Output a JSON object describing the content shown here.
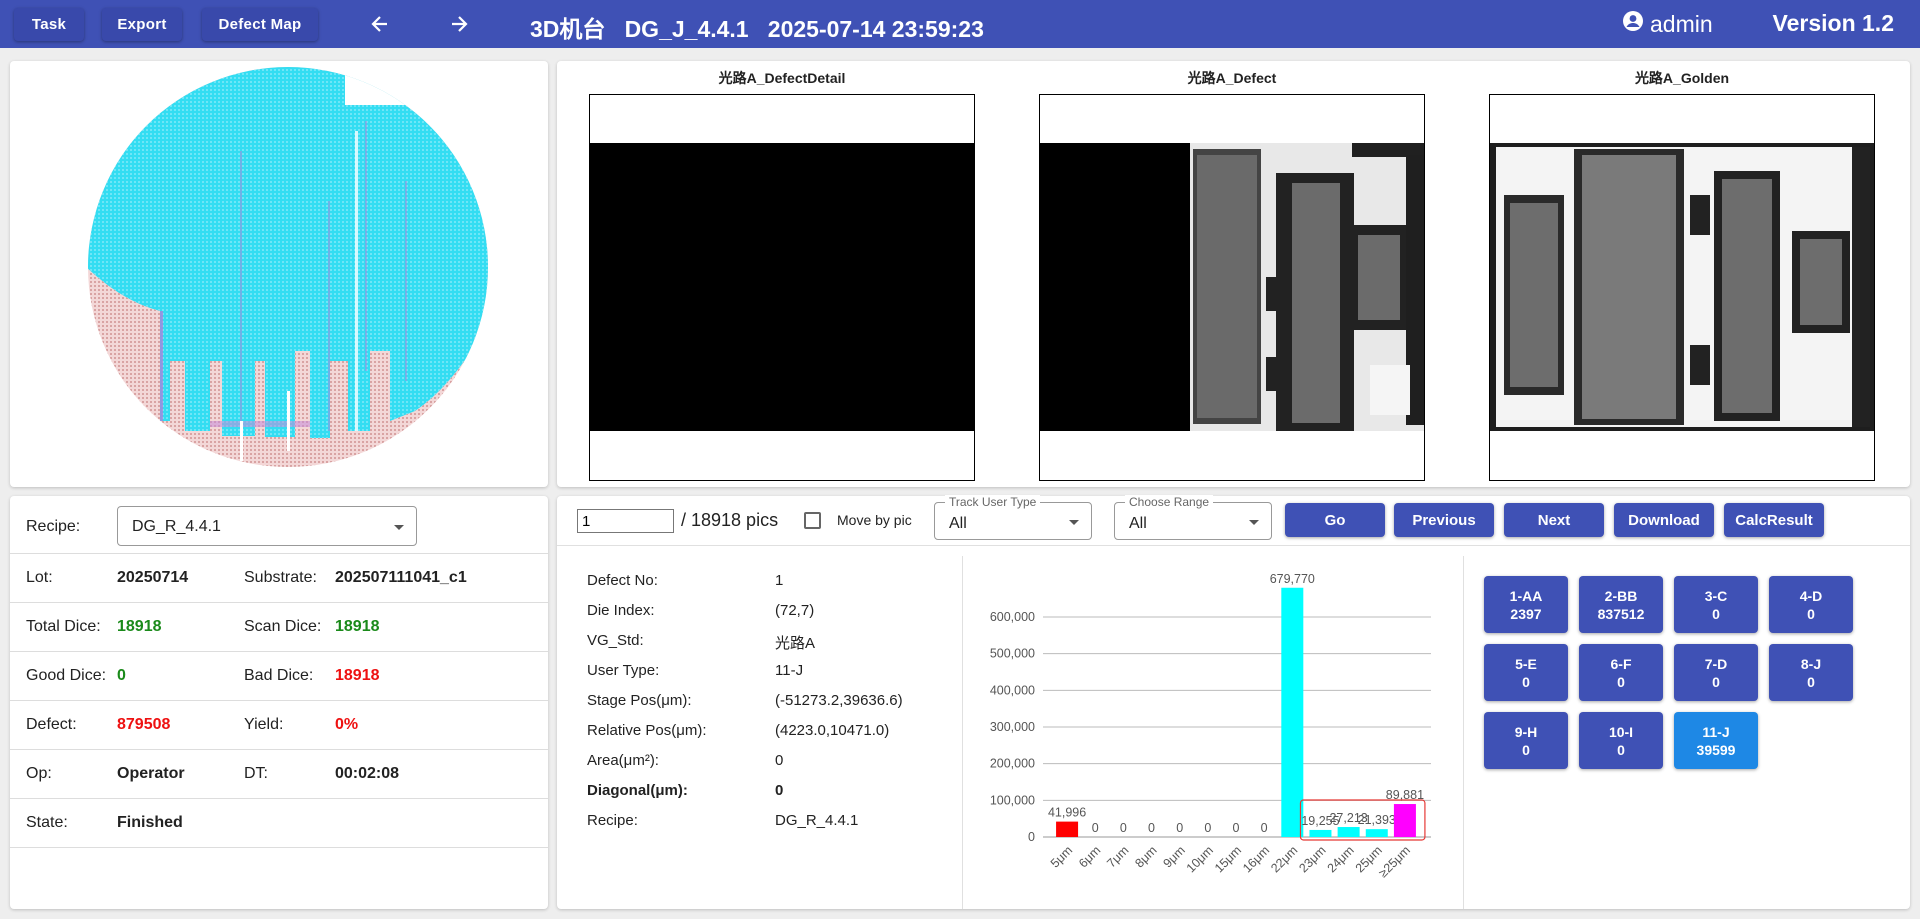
{
  "toolbar": {
    "task_label": "Task",
    "export_label": "Export",
    "defect_map_label": "Defect Map",
    "title": "3D机台   DG_J_4.4.1   2025-07-14 23:59:23",
    "user": "admin",
    "version": "Version 1.2"
  },
  "images": [
    {
      "title": "光路A_DefectDetail"
    },
    {
      "title": "光路A_Defect"
    },
    {
      "title": "光路A_Golden"
    }
  ],
  "info": {
    "recipe_label": "Recipe:",
    "recipe_value": "DG_R_4.4.1",
    "lot_label": "Lot:",
    "lot_value": "20250714",
    "substrate_label": "Substrate:",
    "substrate_value": "202507111041_c1",
    "total_dice_label": "Total Dice:",
    "total_dice_value": "18918",
    "scan_dice_label": "Scan Dice:",
    "scan_dice_value": "18918",
    "good_dice_label": "Good Dice:",
    "good_dice_value": "0",
    "bad_dice_label": "Bad Dice:",
    "bad_dice_value": "18918",
    "defect_label": "Defect:",
    "defect_value": "879508",
    "yield_label": "Yield:",
    "yield_value": "0%",
    "op_label": "Op:",
    "op_value": "Operator",
    "dt_label": "DT:",
    "dt_value": "00:02:08",
    "state_label": "State:",
    "state_value": "Finished"
  },
  "controls": {
    "page_value": "1",
    "page_total": "/ 18918 pics",
    "move_by_pic_label": "Move by pic",
    "track_user_type_label": "Track User Type",
    "track_user_type_value": "All",
    "choose_range_label": "Choose Range",
    "choose_range_value": "All",
    "go_label": "Go",
    "previous_label": "Previous",
    "next_label": "Next",
    "download_label": "Download",
    "calc_result_label": "CalcResult"
  },
  "defect": {
    "rows": [
      {
        "label": "Defect No:",
        "value": "1",
        "bold": false
      },
      {
        "label": "Die Index:",
        "value": "(72,7)",
        "bold": false
      },
      {
        "label": "VG_Std:",
        "value": "光路A",
        "bold": false
      },
      {
        "label": "User Type:",
        "value": "11-J",
        "bold": false
      },
      {
        "label": "Stage Pos(μm):",
        "value": "(-51273.2,39636.6)",
        "bold": false
      },
      {
        "label": "Relative Pos(μm):",
        "value": "(4223.0,10471.0)",
        "bold": false
      },
      {
        "label": "Area(μm²):",
        "value": "0",
        "bold": false
      },
      {
        "label": "Diagonal(μm):",
        "value": "0",
        "bold": true
      },
      {
        "label": "Recipe:",
        "value": "DG_R_4.4.1",
        "bold": false
      }
    ]
  },
  "chart_data": {
    "type": "bar",
    "categories": [
      "5μm",
      "6μm",
      "7μm",
      "8μm",
      "9μm",
      "10μm",
      "15μm",
      "16μm",
      "22μm",
      "23μm",
      "24μm",
      "25μm",
      "≥25μm"
    ],
    "values": [
      41996,
      0,
      0,
      0,
      0,
      0,
      0,
      0,
      679770,
      19255,
      27213,
      21393,
      89881
    ],
    "value_labels": [
      "41,996",
      "0",
      "0",
      "0",
      "0",
      "0",
      "0",
      "0",
      "679,770",
      "19,255",
      "27,213",
      "21,393",
      "89,881"
    ],
    "colors": [
      "#ff0000",
      "#00ffff",
      "#00ffff",
      "#00ffff",
      "#00ffff",
      "#00ffff",
      "#00ffff",
      "#00ffff",
      "#00ffff",
      "#00ffff",
      "#00ffff",
      "#00ffff",
      "#ff00ff"
    ],
    "ylim": [
      0,
      600000
    ],
    "yticks": [
      0,
      100000,
      200000,
      300000,
      400000,
      500000,
      600000
    ],
    "ytick_labels": [
      "0",
      "100,000",
      "200,000",
      "300,000",
      "400,000",
      "500,000",
      "600,000"
    ],
    "grid": true,
    "highlight_categories": [
      "23μm",
      "24μm",
      "25μm",
      "≥25μm"
    ]
  },
  "categories": [
    {
      "label": "1-AA",
      "count": "2397",
      "active": false
    },
    {
      "label": "2-BB",
      "count": "837512",
      "active": false
    },
    {
      "label": "3-C",
      "count": "0",
      "active": false
    },
    {
      "label": "4-D",
      "count": "0",
      "active": false
    },
    {
      "label": "5-E",
      "count": "0",
      "active": false
    },
    {
      "label": "6-F",
      "count": "0",
      "active": false
    },
    {
      "label": "7-D",
      "count": "0",
      "active": false
    },
    {
      "label": "8-J",
      "count": "0",
      "active": false
    },
    {
      "label": "9-H",
      "count": "0",
      "active": false
    },
    {
      "label": "10-I",
      "count": "0",
      "active": false
    },
    {
      "label": "11-J",
      "count": "39599",
      "active": true
    }
  ],
  "icons": {
    "back": "arrow-left-icon",
    "forward": "arrow-right-icon",
    "user": "account-circle-icon",
    "dropdown": "caret-down-icon"
  }
}
